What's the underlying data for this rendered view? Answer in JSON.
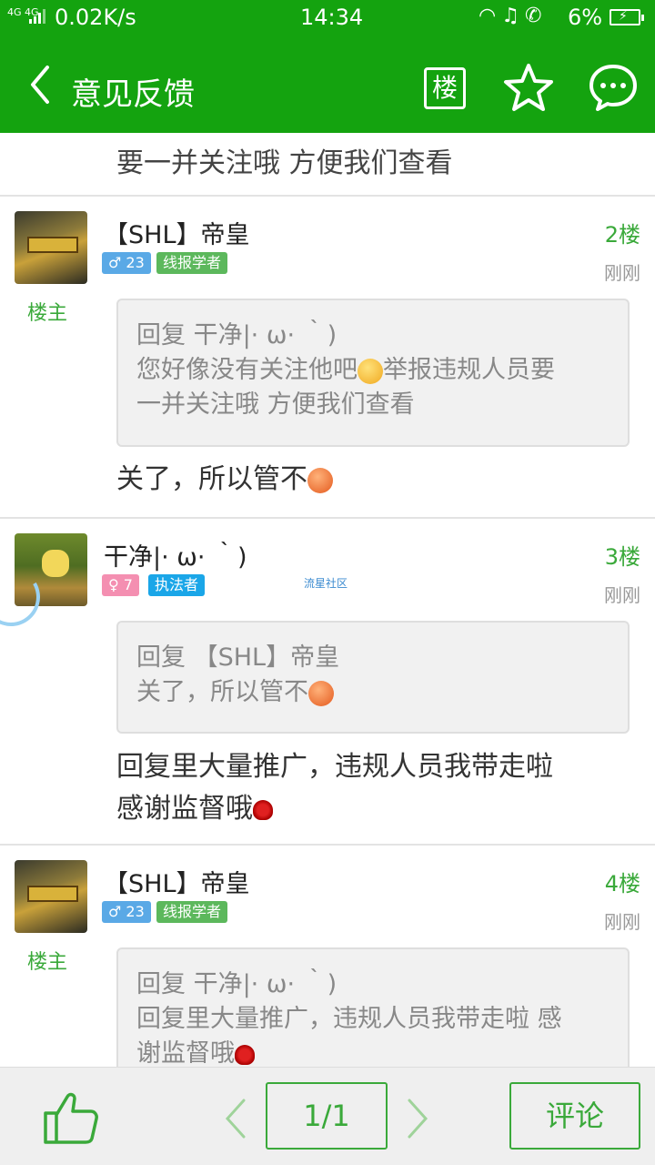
{
  "status_bar": {
    "network": "4G 4G",
    "speed": "0.02K/s",
    "time": "14:34",
    "icons": [
      "headset-icon",
      "mute-icon",
      "hd-call-icon"
    ],
    "battery_percent": "6%"
  },
  "app_bar": {
    "title": "意见反馈",
    "floor_button": "楼"
  },
  "content": {
    "previous_tail": "要一并关注哦 方便我们查看",
    "posts": [
      {
        "username": "【SHL】帝皇",
        "gender_level": "♂ 23",
        "title_badge": "线报学者",
        "owner_label": "楼主",
        "floor": "2楼",
        "time": "刚刚",
        "quote_lines": [
          "回复 干净|· ω· ｀)",
          "您好像没有关注他吧",
          "举报违规人员要",
          "一并关注哦 方便我们查看"
        ],
        "reply": "关了，所以管不"
      },
      {
        "username": "干净|· ω· ｀)",
        "gender_level": "♀ 7",
        "title_badge": "执法者",
        "watermark": "流星社区",
        "floor": "3楼",
        "time": "刚刚",
        "quote_lines": [
          "回复 【SHL】帝皇",
          "关了，所以管不"
        ],
        "reply_lines": [
          "回复里大量推广，违规人员我带走啦",
          "感谢监督哦"
        ]
      },
      {
        "username": "【SHL】帝皇",
        "gender_level": "♂ 23",
        "title_badge": "线报学者",
        "owner_label": "楼主",
        "floor": "4楼",
        "time": "刚刚",
        "quote_lines": [
          "回复 干净|· ω· ｀)",
          "回复里大量推广，违规人员我带走啦 感",
          "谢监督哦"
        ]
      }
    ]
  },
  "bottom_bar": {
    "pager": "1/1",
    "comment": "评论"
  },
  "colors": {
    "brand_green": "#14a30f",
    "accent_green": "#3aa93a",
    "badge_blue": "#5aa9e6",
    "badge_green": "#5cb85c",
    "badge_pink": "#f48fb1",
    "badge_cyan": "#1aa6e8"
  }
}
